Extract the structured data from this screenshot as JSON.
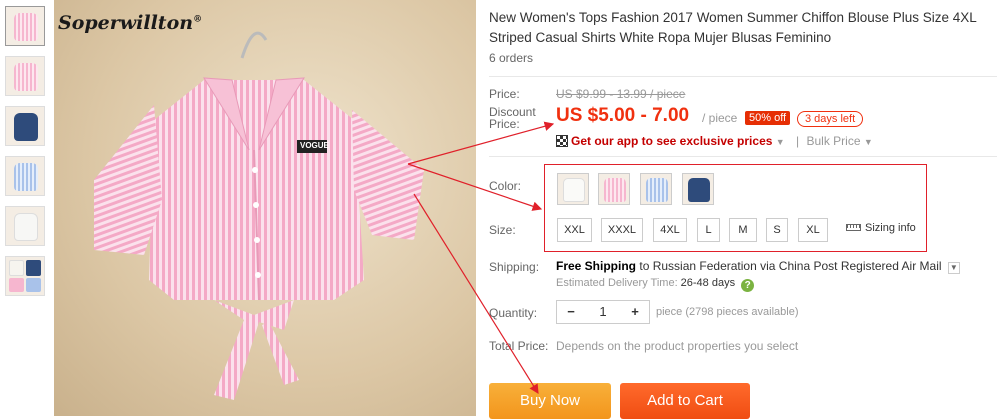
{
  "brand": {
    "name": "Soperwillton",
    "mark": "®"
  },
  "product": {
    "title": "New Women's Tops Fashion 2017 Women Summer Chiffon Blouse Plus Size 4XL Striped Casual Shirts White Ropa Mujer Blusas Feminino",
    "orders": "6 orders",
    "shirt_label": "VOGUE"
  },
  "price": {
    "label": "Price:",
    "original": "US $9.99 - 13.99 / piece",
    "discount_label_1": "Discount",
    "discount_label_2": "Price:",
    "discount": "US $5.00 - 7.00",
    "per": "/ piece",
    "off_badge": "50% off",
    "days_left": "3 days left",
    "app_promo": "Get our app to see exclusive prices",
    "bulk": "Bulk Price"
  },
  "options": {
    "color_label": "Color:",
    "colors": [
      "white",
      "pink",
      "blue",
      "navy"
    ],
    "size_label": "Size:",
    "sizes": [
      "XXL",
      "XXXL",
      "4XL",
      "L",
      "M",
      "S",
      "XL"
    ],
    "sizing_info": "Sizing info"
  },
  "shipping": {
    "label": "Shipping:",
    "free": "Free Shipping",
    "to": "to",
    "country": "Russian Federation",
    "via": "via China Post Registered Air Mail",
    "eta_label": "Estimated Delivery Time:",
    "eta_days": "26-48 days",
    "help_icon": "?"
  },
  "quantity": {
    "label": "Quantity:",
    "minus": "−",
    "value": "1",
    "plus": "+",
    "note": "piece (2798 pieces available)"
  },
  "total": {
    "label": "Total Price:",
    "note": "Depends on the product properties you select"
  },
  "buttons": {
    "buy": "Buy Now",
    "cart": "Add to Cart"
  },
  "colors": {
    "accent_red": "#f0300f",
    "buy": "#f5a623",
    "cart": "#f04d12",
    "annotation": "#e0202a"
  }
}
